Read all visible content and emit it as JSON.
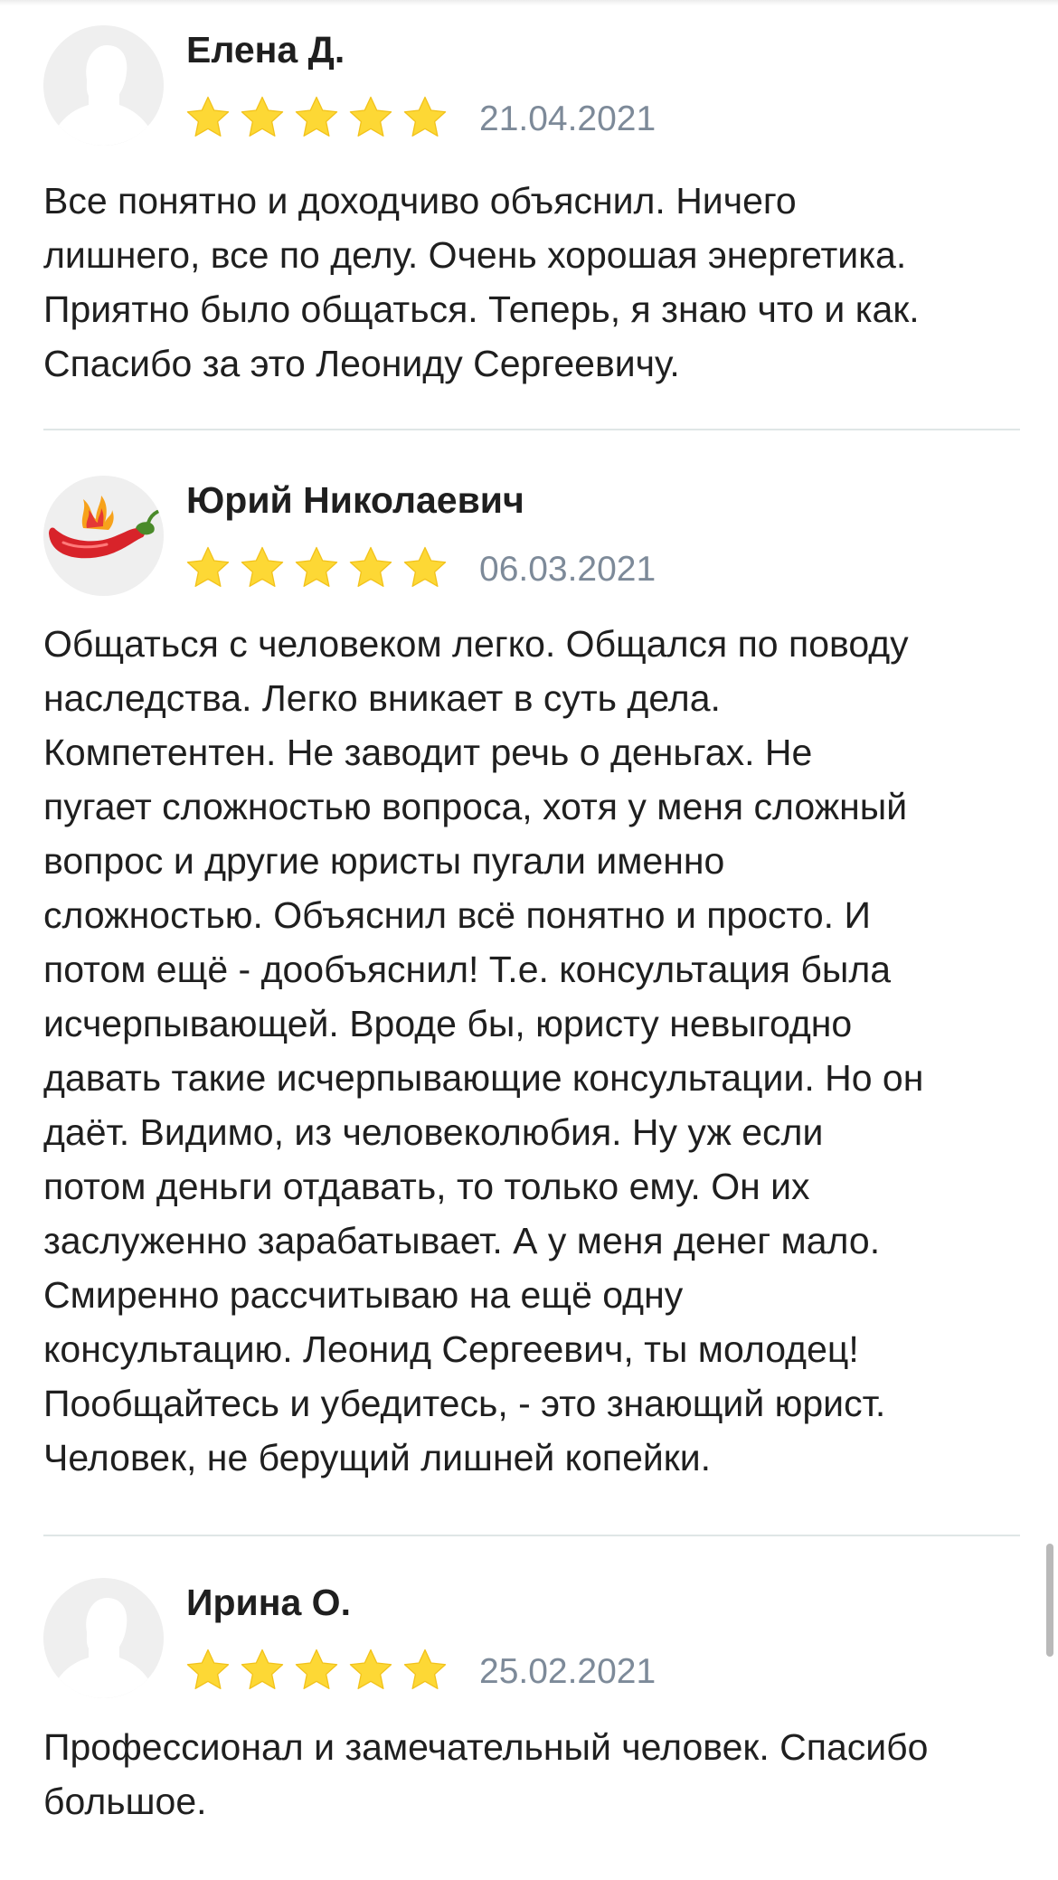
{
  "reviews": [
    {
      "author": "Елена Д.",
      "date": "21.04.2021",
      "rating": 5,
      "avatar": "default-user-silhouette",
      "text": "Все понятно и доходчиво объяснил. Ничего\nлишнего, все по делу. Очень хорошая энергетика.\nПриятно было общаться. Теперь, я знаю что и как.\nСпасибо за это Леониду Сергеевичу."
    },
    {
      "author": "Юрий Николаевич",
      "date": "06.03.2021",
      "rating": 5,
      "avatar": "chili-pepper",
      "text": "Общаться с человеком легко. Общался по поводу\nнаследства. Легко вникает в суть дела.\nКомпетентен. Не заводит речь о деньгах. Не\nпугает сложностью вопроса, хотя у меня сложный\nвопрос и другие юристы пугали именно\nсложностью. Объяснил всё понятно и просто. И\nпотом ещё - дообъяснил! Т.е. консультация была\nисчерпывающей. Вроде бы, юристу невыгодно\nдавать такие исчерпывающие консультации. Но он\nдаёт. Видимо, из человеколюбия. Ну уж если\nпотом деньги отдавать, то только ему. Он их\nзаслуженно зарабатывает. А у меня денег мало.\nСмиренно рассчитываю на ещё одну\nконсультацию. Леонид Сергеевич, ты молодец!\nПообщайтесь и убедитесь, - это знающий юрист.\nЧеловек, не берущий лишней копейки."
    },
    {
      "author": "Ирина О.",
      "date": "25.02.2021",
      "rating": 5,
      "avatar": "default-user-silhouette",
      "text": "Профессионал и замечательный человек. Спасибо\nбольшое."
    }
  ],
  "colors": {
    "star": "#fdd835",
    "date": "#7d8a99",
    "divider": "#dfe6e6",
    "text": "#1f1f1f"
  }
}
